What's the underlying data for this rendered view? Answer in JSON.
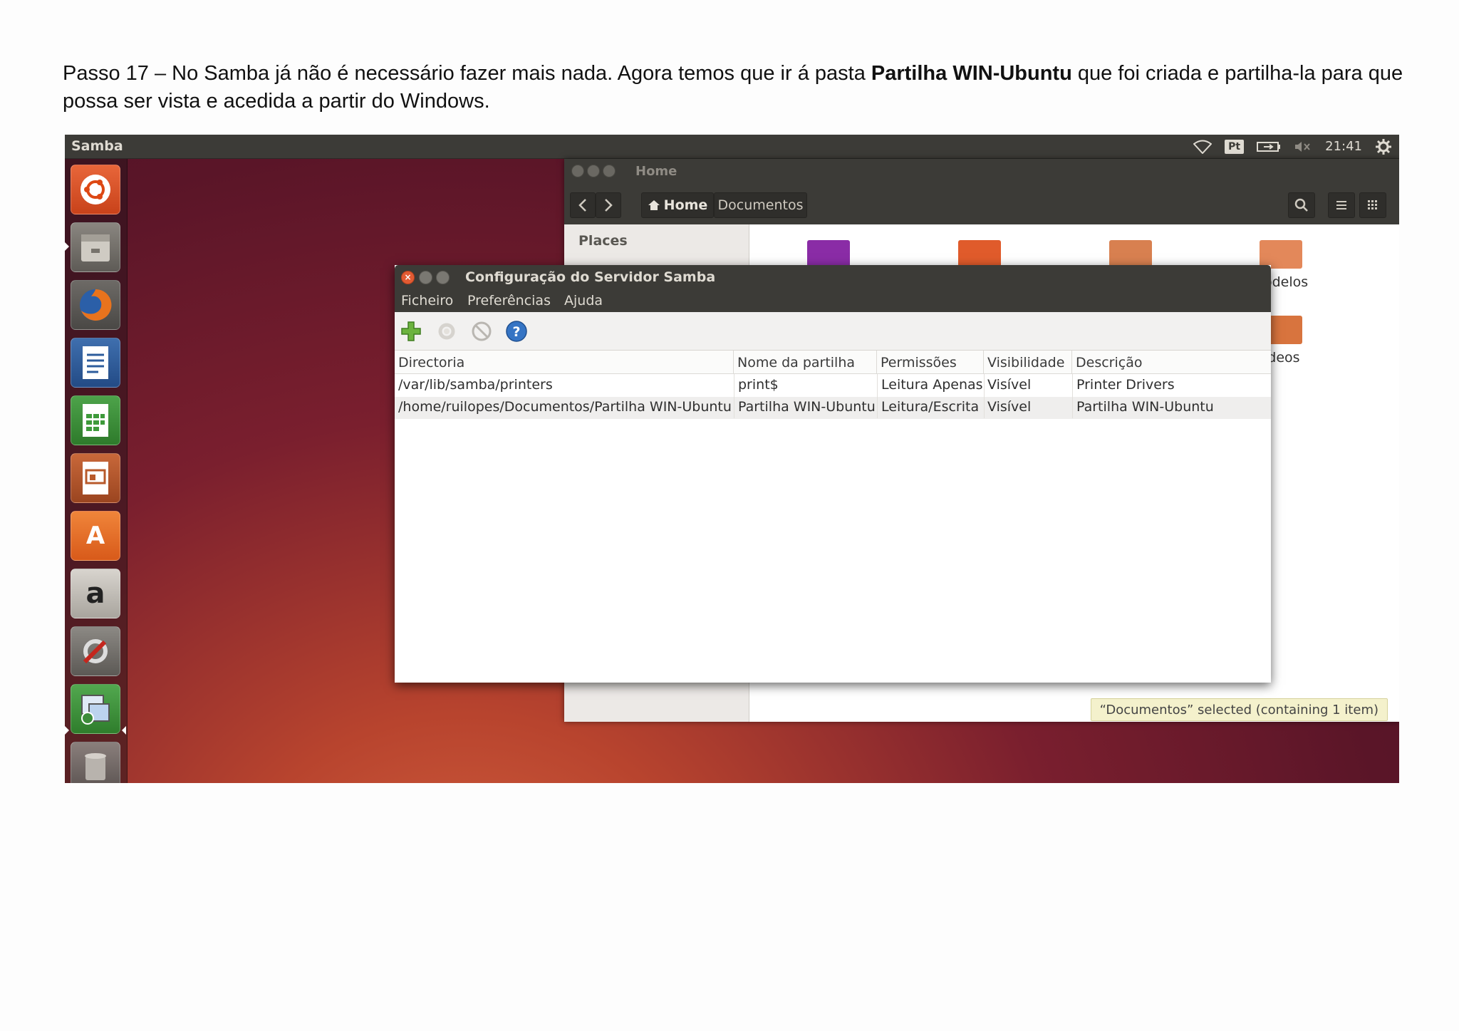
{
  "doc": {
    "p1": "Passo 17 – No Samba já não é necessário fazer mais nada. Agora temos que ir á pasta ",
    "bold": "Partilha WIN-Ubuntu",
    "p2": " que foi criada e partilha-la para que possa ser vista e acedida a partir do Windows."
  },
  "topbar": {
    "app_title": "Samba",
    "keyboard_layout": "Pt",
    "clock": "21:41"
  },
  "launcher": {
    "items": [
      "ubuntu-dash",
      "files",
      "firefox",
      "libreoffice-writer",
      "libreoffice-calc",
      "libreoffice-impress",
      "ubuntu-software-center",
      "amazon",
      "system-settings",
      "samba-config",
      "trash"
    ]
  },
  "nautilus": {
    "window_title": "Home",
    "path_home": "Home",
    "path_documentos": "Documentos",
    "sidebar_heading": "Places",
    "label_modelos_partial": "odelos",
    "label_videos_partial": "ídeos",
    "status": "“Documentos” selected  (containing 1 item)"
  },
  "samba": {
    "title": "Configuração do Servidor Samba",
    "menu": [
      "Ficheiro",
      "Preferências",
      "Ajuda"
    ],
    "columns": [
      "Directoria",
      "Nome da partilha",
      "Permissões",
      "Visibilidade",
      "Descrição"
    ],
    "rows": [
      [
        "/var/lib/samba/printers",
        "print$",
        "Leitura Apenas",
        "Visível",
        "Printer Drivers"
      ],
      [
        "/home/ruilopes/Documentos/Partilha WIN-Ubuntu",
        "Partilha WIN-Ubuntu",
        "Leitura/Escrita",
        "Visível",
        "Partilha WIN-Ubuntu"
      ]
    ]
  },
  "colors": {
    "panel": "#3c3b37",
    "accent_orange": "#e95420",
    "status_bg": "#f4f1cc"
  }
}
